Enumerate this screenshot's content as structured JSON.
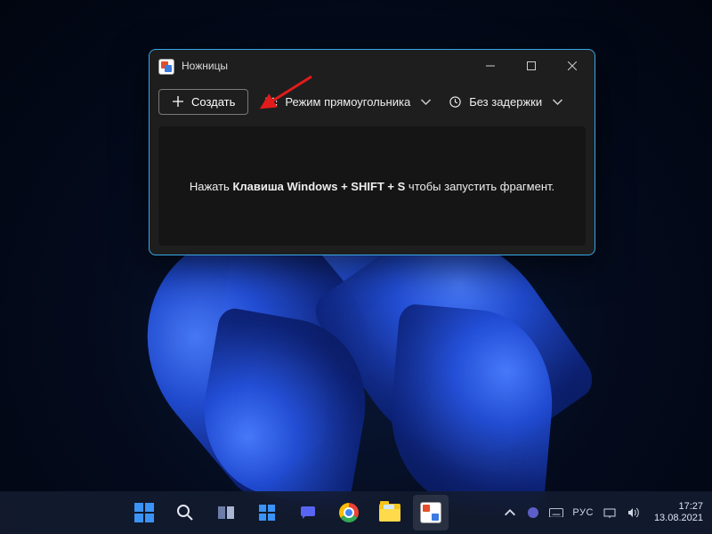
{
  "window": {
    "title": "Ножницы"
  },
  "toolbar": {
    "new_label": "Создать",
    "mode_label": "Режим прямоугольника",
    "delay_label": "Без задержки"
  },
  "hint": {
    "prefix": "Нажать ",
    "shortcut": "Клавиша Windows + SHIFT + S",
    "suffix": " чтобы запустить фрагмент."
  },
  "tray": {
    "lang": "РУС",
    "time": "17:27",
    "date": "13.08.2021"
  }
}
